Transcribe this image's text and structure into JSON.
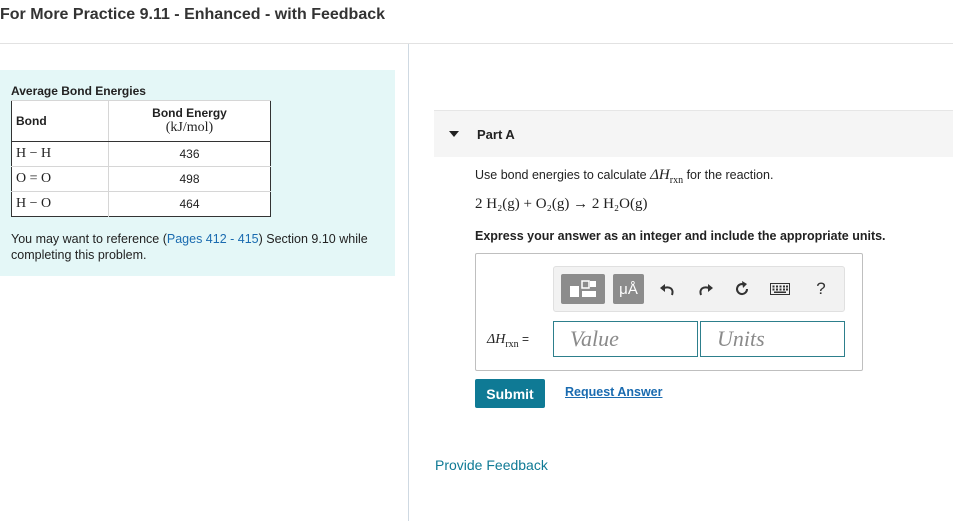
{
  "page": {
    "title": "For More Practice 9.11 - Enhanced - with Feedback"
  },
  "bond_table": {
    "caption": "Average Bond Energies",
    "header_bond": "Bond",
    "header_energy": "Bond Energy",
    "header_energy_unit": "(kJ/mol)",
    "rows": [
      {
        "bond": "H − H",
        "energy": "436"
      },
      {
        "bond": "O = O",
        "energy": "498"
      },
      {
        "bond": "H − O",
        "energy": "464"
      }
    ]
  },
  "reference": {
    "prefix": "You may want to reference (",
    "link": "Pages 412 - 415",
    "suffix": ") Section 9.10 while completing this problem."
  },
  "part": {
    "label": "Part A",
    "question_prefix": "Use bond energies to calculate ",
    "question_symbol": "ΔH",
    "question_subscript": "rxn",
    "question_suffix": " for the reaction.",
    "reaction": "2 H₂(g) + O₂(g) → 2 H₂O(g)",
    "instruction": "Express your answer as an integer and include the appropriate units."
  },
  "answer": {
    "label_symbol": "ΔH",
    "label_subscript": "rxn",
    "label_equals": " =",
    "value_placeholder": "Value",
    "units_placeholder": "Units",
    "toolbar": {
      "units_label": "μÅ",
      "help_label": "?",
      "icons": [
        "templates-icon",
        "units-icon",
        "undo-icon",
        "redo-icon",
        "reset-icon",
        "keyboard-icon",
        "help-icon"
      ]
    }
  },
  "actions": {
    "submit_label": "Submit",
    "request_answer_label": "Request Answer",
    "provide_feedback_label": "Provide Feedback"
  },
  "colors": {
    "accent": "#0f7a95",
    "link": "#1a6bb0",
    "panel": "#e4f7f7"
  }
}
